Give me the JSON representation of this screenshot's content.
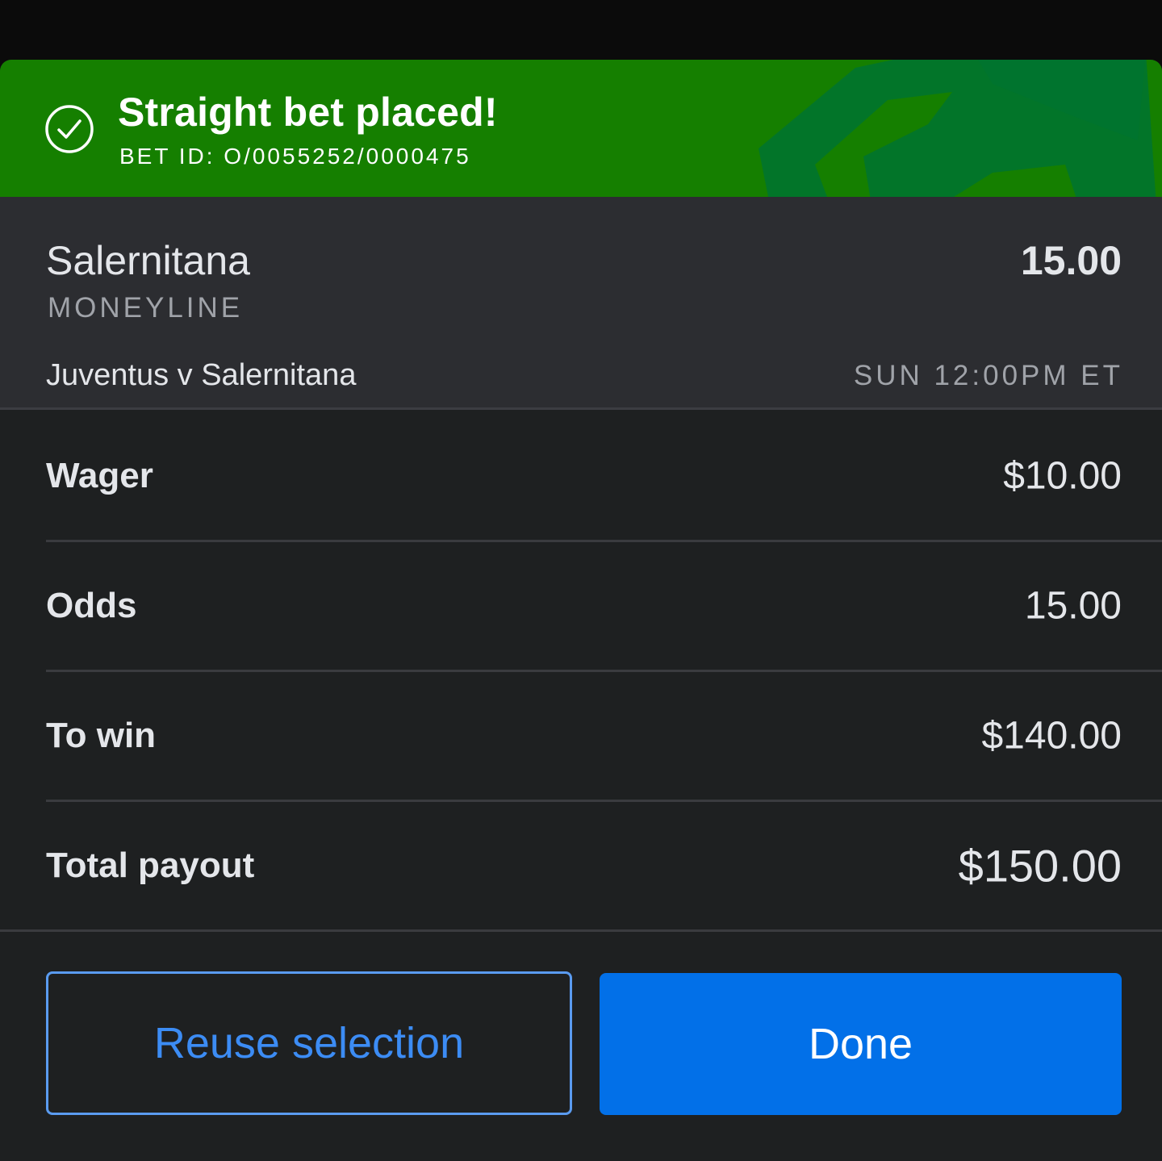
{
  "banner": {
    "title": "Straight bet placed!",
    "bet_id": "BET ID: O/0055252/0000475",
    "color": "#157f00"
  },
  "selection": {
    "name": "Salernitana",
    "market": "MONEYLINE",
    "odds": "15.00",
    "event": "Juventus v Salernitana",
    "time": "SUN 12:00PM ET"
  },
  "details": [
    {
      "label": "Wager",
      "value": "$10.00"
    },
    {
      "label": "Odds",
      "value": "15.00"
    },
    {
      "label": "To win",
      "value": "$140.00"
    },
    {
      "label": "Total payout",
      "value": "$150.00"
    }
  ],
  "actions": {
    "reuse_label": "Reuse selection",
    "done_label": "Done",
    "accent": "#0270e8"
  },
  "icons": [
    "check-circle-icon",
    "brand-logo-icon"
  ]
}
